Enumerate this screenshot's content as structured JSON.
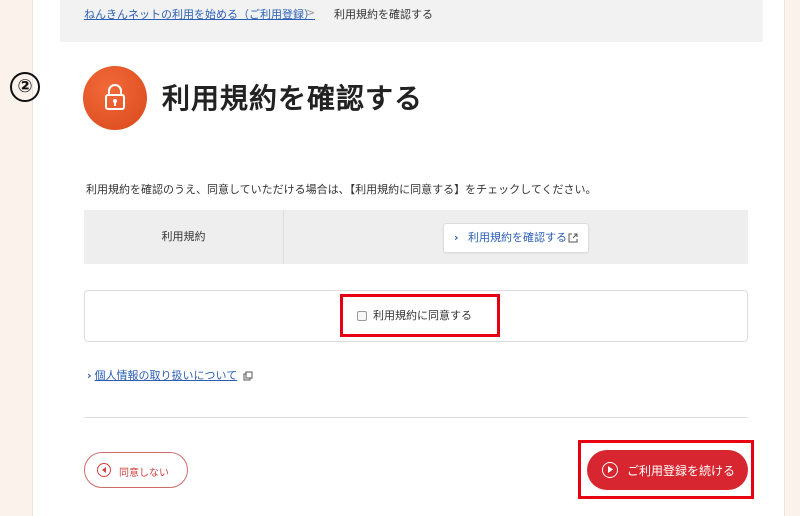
{
  "breadcrumb": {
    "link_label": "ねんきんネットの利用を始める（ご利用登録）",
    "separator": ">",
    "current_label": "利用規約を確認する"
  },
  "step_marker": "②",
  "page": {
    "title": "利用規約を確認する",
    "title_icon": "lock-icon",
    "instruction": "利用規約を確認のうえ、同意していただける場合は、【利用規約に同意する】をチェックしてください。"
  },
  "terms": {
    "row_label": "利用規約",
    "button_label": "利用規約を確認する",
    "button_icon": "external-link-icon"
  },
  "agree": {
    "checkbox_label": "利用規約に同意する",
    "checked": false
  },
  "privacy": {
    "link_label": "個人情報の取り扱いについて"
  },
  "actions": {
    "decline_label": "同意しない",
    "continue_label": "ご利用登録を続ける"
  },
  "colors": {
    "accent": "#d7262f",
    "highlight": "#e60012",
    "link": "#2b5fb5",
    "icon_orange": "#e8562a"
  }
}
